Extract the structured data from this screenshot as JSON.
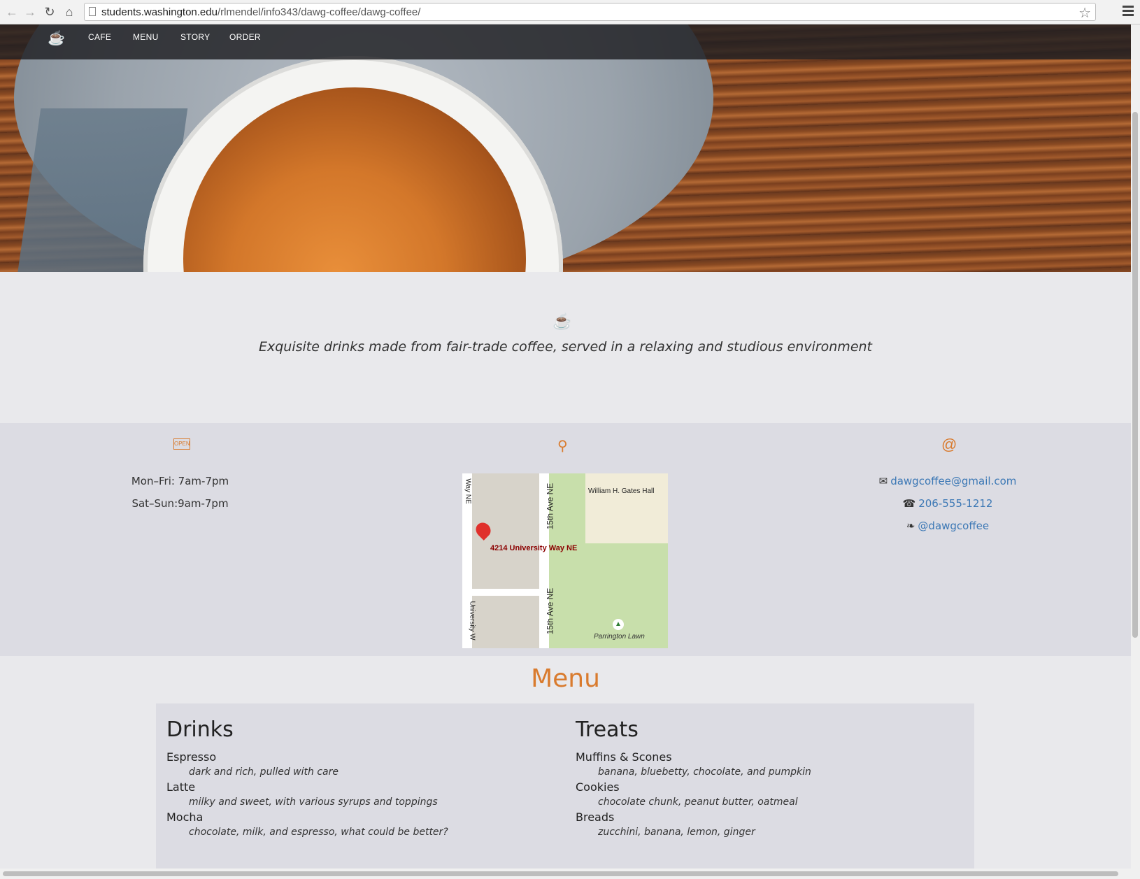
{
  "browser": {
    "url_host": "students.washington.edu",
    "url_path": "/rlmendel/info343/dawg-coffee/dawg-coffee/",
    "back_icon": "back-arrow-icon",
    "forward_icon": "forward-arrow-icon",
    "reload_icon": "reload-icon",
    "home_icon": "home-icon",
    "bookmark_icon": "star-icon",
    "menu_icon": "hamburger-icon"
  },
  "nav": {
    "brand_icon": "coffee-cup-icon",
    "links": [
      "CAFE",
      "MENU",
      "STORY",
      "ORDER"
    ]
  },
  "intro": {
    "icon": "coffee-cup-icon",
    "tagline": "Exquisite drinks made from fair-trade coffee, served in a relaxing and studious environment"
  },
  "info": {
    "hours": [
      "Mon–Fri: 7am-7pm",
      "Sat–Sun:9am-7pm"
    ],
    "map": {
      "address_label": "4214 University Way NE",
      "labels": [
        "William H. Gates Hall",
        "15th Ave NE",
        "15th Ave NE",
        "University W",
        "Way NE",
        "Parrington Lawn"
      ]
    },
    "contact": {
      "email": "dawgcoffee@gmail.com",
      "phone": "206-555-1212",
      "twitter": "@dawgcoffee"
    }
  },
  "menu": {
    "title": "Menu",
    "drinks": {
      "heading": "Drinks",
      "items": [
        {
          "name": "Espresso",
          "desc": "dark and rich, pulled with care"
        },
        {
          "name": "Latte",
          "desc": "milky and sweet, with various syrups and toppings"
        },
        {
          "name": "Mocha",
          "desc": "chocolate, milk, and espresso, what could be better?"
        }
      ]
    },
    "treats": {
      "heading": "Treats",
      "items": [
        {
          "name": "Muffins & Scones",
          "desc": "banana, bluebetty, chocolate, and pumpkin"
        },
        {
          "name": "Cookies",
          "desc": "chocolate chunk, peanut butter, oatmeal"
        },
        {
          "name": "Breads",
          "desc": "zucchini, banana, lemon, ginger"
        }
      ]
    }
  },
  "colors": {
    "accent": "#d97b2e",
    "link": "#3c78b5",
    "navbar": "#1e1e22",
    "band": "#dcdce3"
  }
}
